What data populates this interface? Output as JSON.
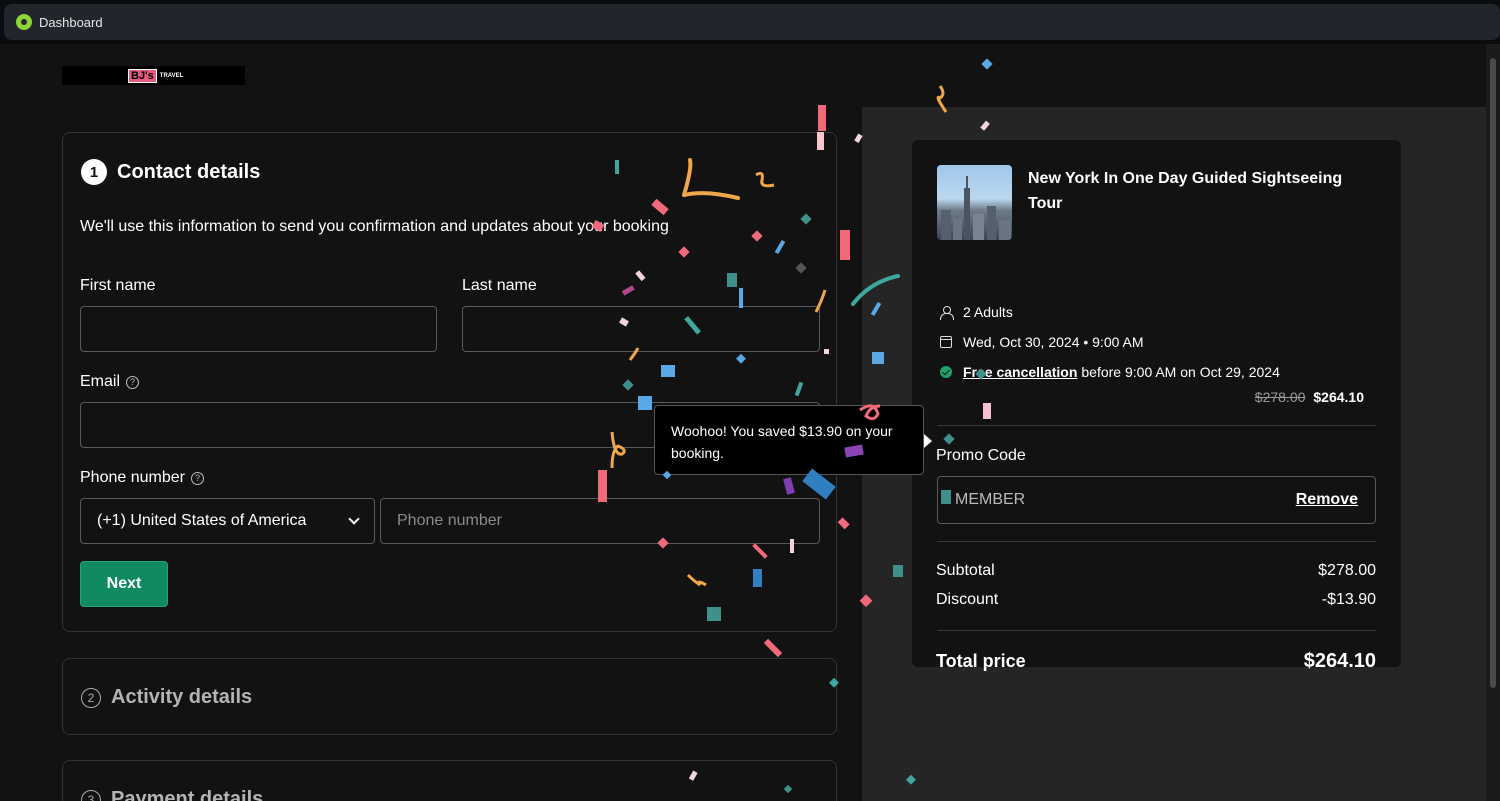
{
  "browser": {
    "tab_title": "Dashboard"
  },
  "brand": {
    "logo_mark": "BJ's",
    "logo_text": "TRAVEL"
  },
  "contact": {
    "step": "1",
    "title": "Contact details",
    "subtitle": "We'll use this information to send you confirmation and updates about your booking",
    "first_name_label": "First name",
    "last_name_label": "Last name",
    "email_label": "Email",
    "phone_label": "Phone number",
    "country_value": "(+1) United States of America",
    "phone_placeholder": "Phone number",
    "next_label": "Next"
  },
  "activity": {
    "step": "2",
    "title": "Activity details"
  },
  "payment": {
    "step": "3",
    "title": "Payment details"
  },
  "tooltip": {
    "text": "Woohoo! You saved $13.90 on your booking."
  },
  "summary": {
    "tour_title": "New York In One Day Guided Sightseeing Tour",
    "guests": "2 Adults",
    "date": "Wed, Oct 30, 2024 • 9:00 AM",
    "free_cancel_link": "Free cancellation",
    "free_cancel_rest": "before 9:00 AM on Oct 29, 2024",
    "old_price": "$278.00",
    "new_price": "$264.10",
    "promo_label": "Promo Code",
    "promo_code": "MEMBER",
    "remove_label": "Remove",
    "subtotal_label": "Subtotal",
    "subtotal_value": "$278.00",
    "discount_label": "Discount",
    "discount_value": "-$13.90",
    "total_label": "Total price",
    "total_value": "$264.10"
  },
  "colors": {
    "accent_green": "#0f8a63",
    "check_green": "#22a06b",
    "brand_pink": "#e35b7f"
  },
  "icons": [
    "help-icon",
    "chevron-down-icon",
    "person-icon",
    "calendar-icon",
    "check-circle-icon"
  ]
}
